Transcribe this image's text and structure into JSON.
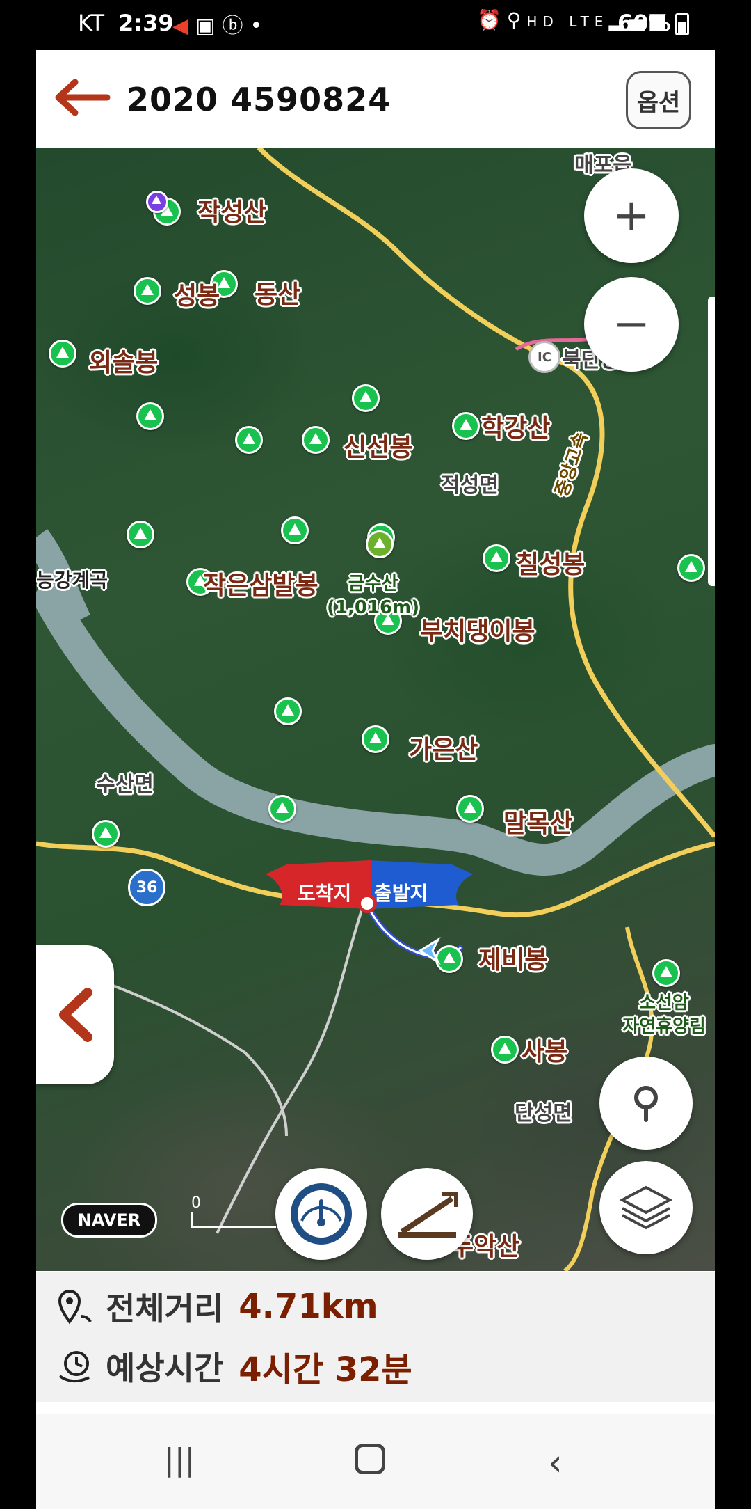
{
  "status_bar": {
    "carrier": "KT",
    "time": "2:39",
    "battery": "60%"
  },
  "header": {
    "title": "2020 4590824",
    "options_label": "옵션"
  },
  "map": {
    "labels": {
      "maepo": "매포읍",
      "jakseongsan": "작성산",
      "seongbong": "성봉",
      "dongsan": "동산",
      "oesolbong": "외솔봉",
      "bukdan": "북단양",
      "ic": "IC",
      "hakgangsan": "학강산",
      "sinseonbong": "신선봉",
      "jungang": "중앙고속",
      "jeokseongmyeon": "적성면",
      "neunggang": "능강계곡",
      "chilseongbong": "칠성봉",
      "jakeunsambalbong": "작은삼발봉",
      "geumsusan": "금수산",
      "geumsusan_elev": "(1,016m)",
      "buchidaengibong": "부치댕이봉",
      "gaeunsan": "가은산",
      "susanmyeon": "수산면",
      "malmoksan": "말목산",
      "jebibong": "제비봉",
      "soseonam": "소선암",
      "forest": "자연휴양림",
      "sabong": "사봉",
      "danseongmyeon": "단성면",
      "dudusan": "두악산"
    },
    "route_number": "36",
    "arrival_flag": "도착지",
    "departure_flag": "출발지",
    "naver_logo": "NAVER",
    "scale_label": "0",
    "buttons": {
      "zoom_in": "+",
      "zoom_out": "−"
    }
  },
  "summary": {
    "distance_label": "전체거리",
    "distance_value": "4.71km",
    "time_label": "예상시간",
    "time_value": "4시간 32분"
  },
  "colors": {
    "accent": "#b3361a",
    "peak_green": "#19c24e",
    "peak_purple": "#7a3fe0",
    "flag_red": "#d6262a",
    "flag_blue": "#1f5bd1",
    "value_text": "#7a1f00"
  }
}
